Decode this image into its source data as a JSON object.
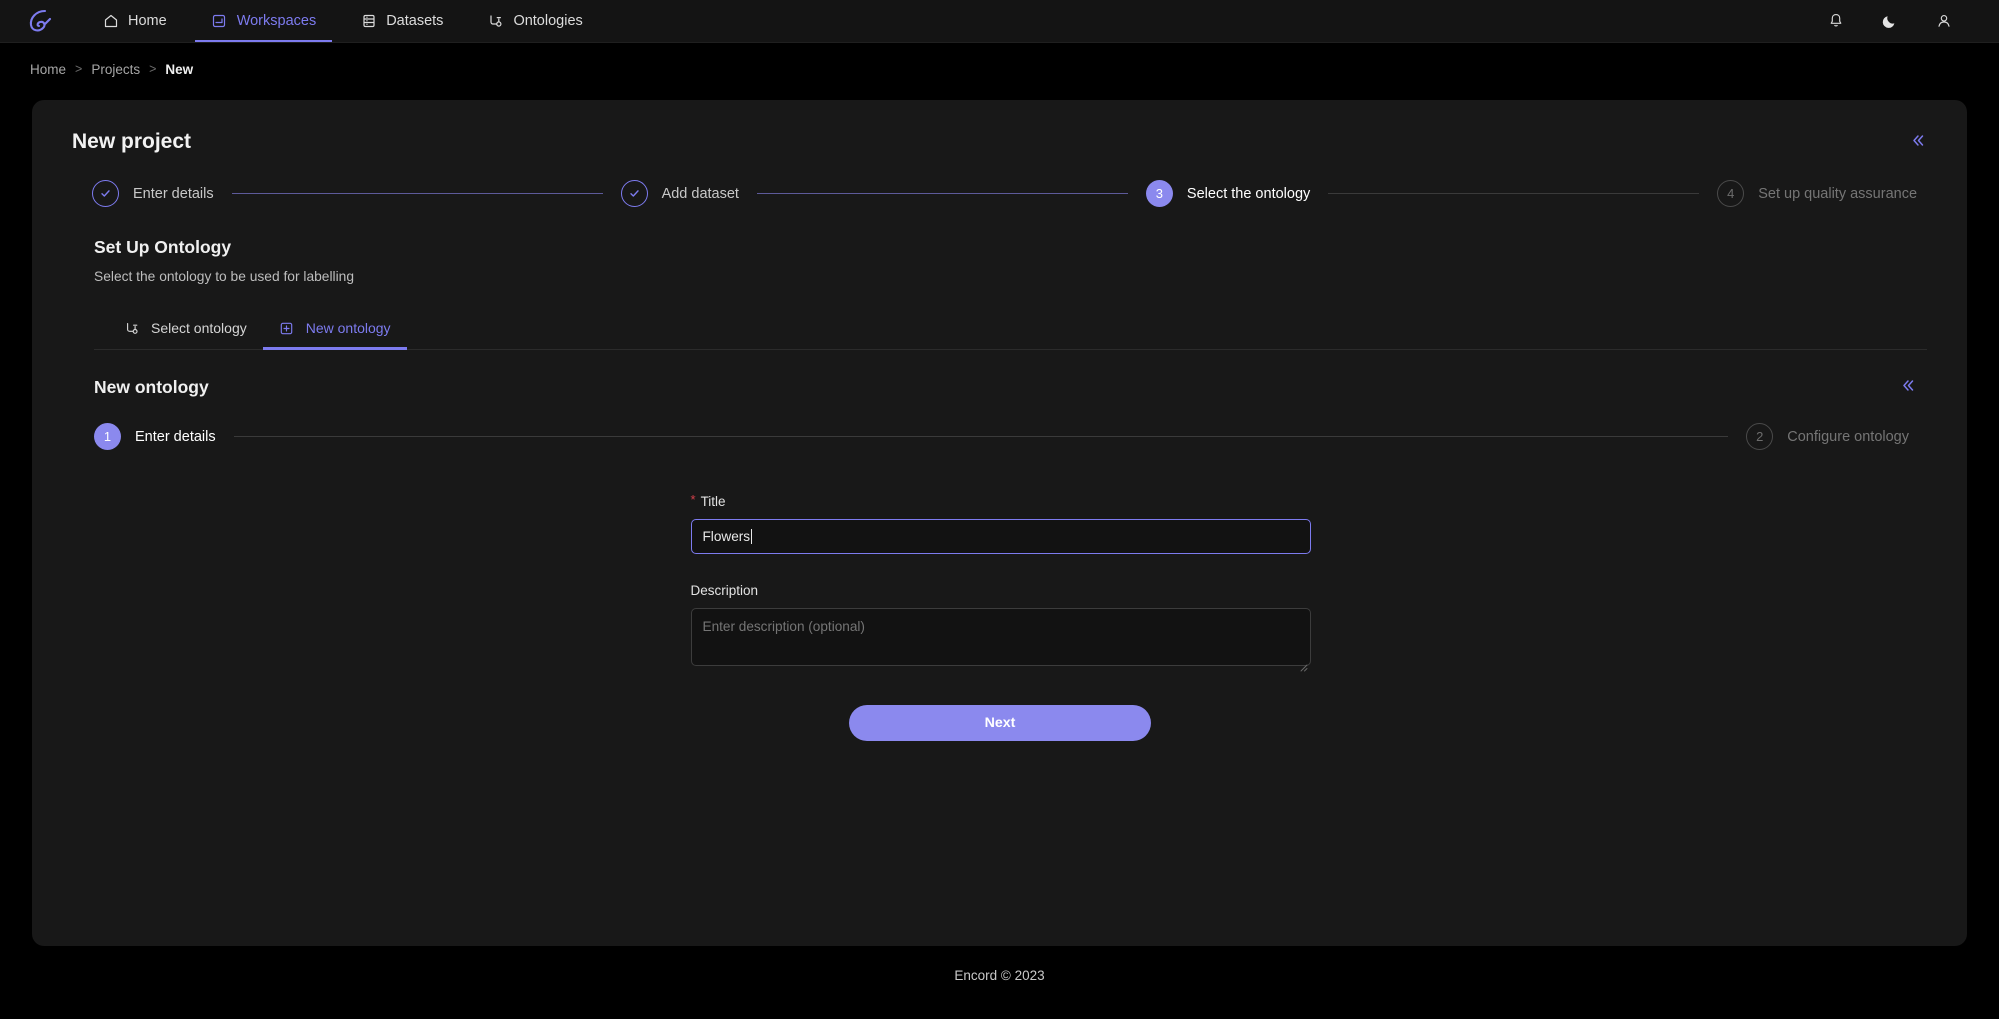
{
  "navbar": {
    "logo_icon": "encord-logo-icon",
    "items": [
      {
        "label": "Home",
        "icon": "home-icon",
        "active": false
      },
      {
        "label": "Workspaces",
        "icon": "workspaces-icon",
        "active": true
      },
      {
        "label": "Datasets",
        "icon": "datasets-icon",
        "active": false
      },
      {
        "label": "Ontologies",
        "icon": "ontologies-icon",
        "active": false
      }
    ],
    "right": [
      {
        "icon": "bell-icon",
        "name": "notifications-button"
      },
      {
        "icon": "moon-icon",
        "name": "dark-mode-toggle"
      },
      {
        "icon": "user-icon",
        "name": "account-button"
      }
    ]
  },
  "breadcrumb": {
    "items": [
      "Home",
      "Projects",
      "New"
    ],
    "separator": ">"
  },
  "card": {
    "title": "New project",
    "collapse_icon": "chevron-double-left-icon",
    "steps": [
      {
        "marker": "✓",
        "label": "Enter details",
        "state": "done"
      },
      {
        "marker": "✓",
        "label": "Add dataset",
        "state": "done"
      },
      {
        "marker": "3",
        "label": "Select the ontology",
        "state": "current"
      },
      {
        "marker": "4",
        "label": "Set up quality assurance",
        "state": "todo"
      }
    ]
  },
  "section": {
    "title": "Set Up Ontology",
    "subtitle": "Select the ontology to be used for labelling",
    "tabs": [
      {
        "label": "Select ontology",
        "icon": "select-ontology-icon",
        "active": false
      },
      {
        "label": "New ontology",
        "icon": "plus-box-icon",
        "active": true
      }
    ]
  },
  "subpanel": {
    "title": "New ontology",
    "collapse_icon": "chevron-double-left-icon",
    "steps": [
      {
        "marker": "1",
        "label": "Enter details",
        "state": "current"
      },
      {
        "marker": "2",
        "label": "Configure ontology",
        "state": "todo"
      }
    ],
    "form": {
      "title_label": "Title",
      "title_required_marker": "*",
      "title_value": "Flowers",
      "description_label": "Description",
      "description_value": "",
      "description_placeholder": "Enter description (optional)",
      "next_label": "Next"
    }
  },
  "footer": {
    "text": "Encord © 2023"
  },
  "colors": {
    "accent": "#7d7bef",
    "accent_solid": "#8b89ee",
    "page_bg": "#000000",
    "nav_bg": "#141414",
    "card_bg": "#181818",
    "required_red": "#d4404a"
  }
}
